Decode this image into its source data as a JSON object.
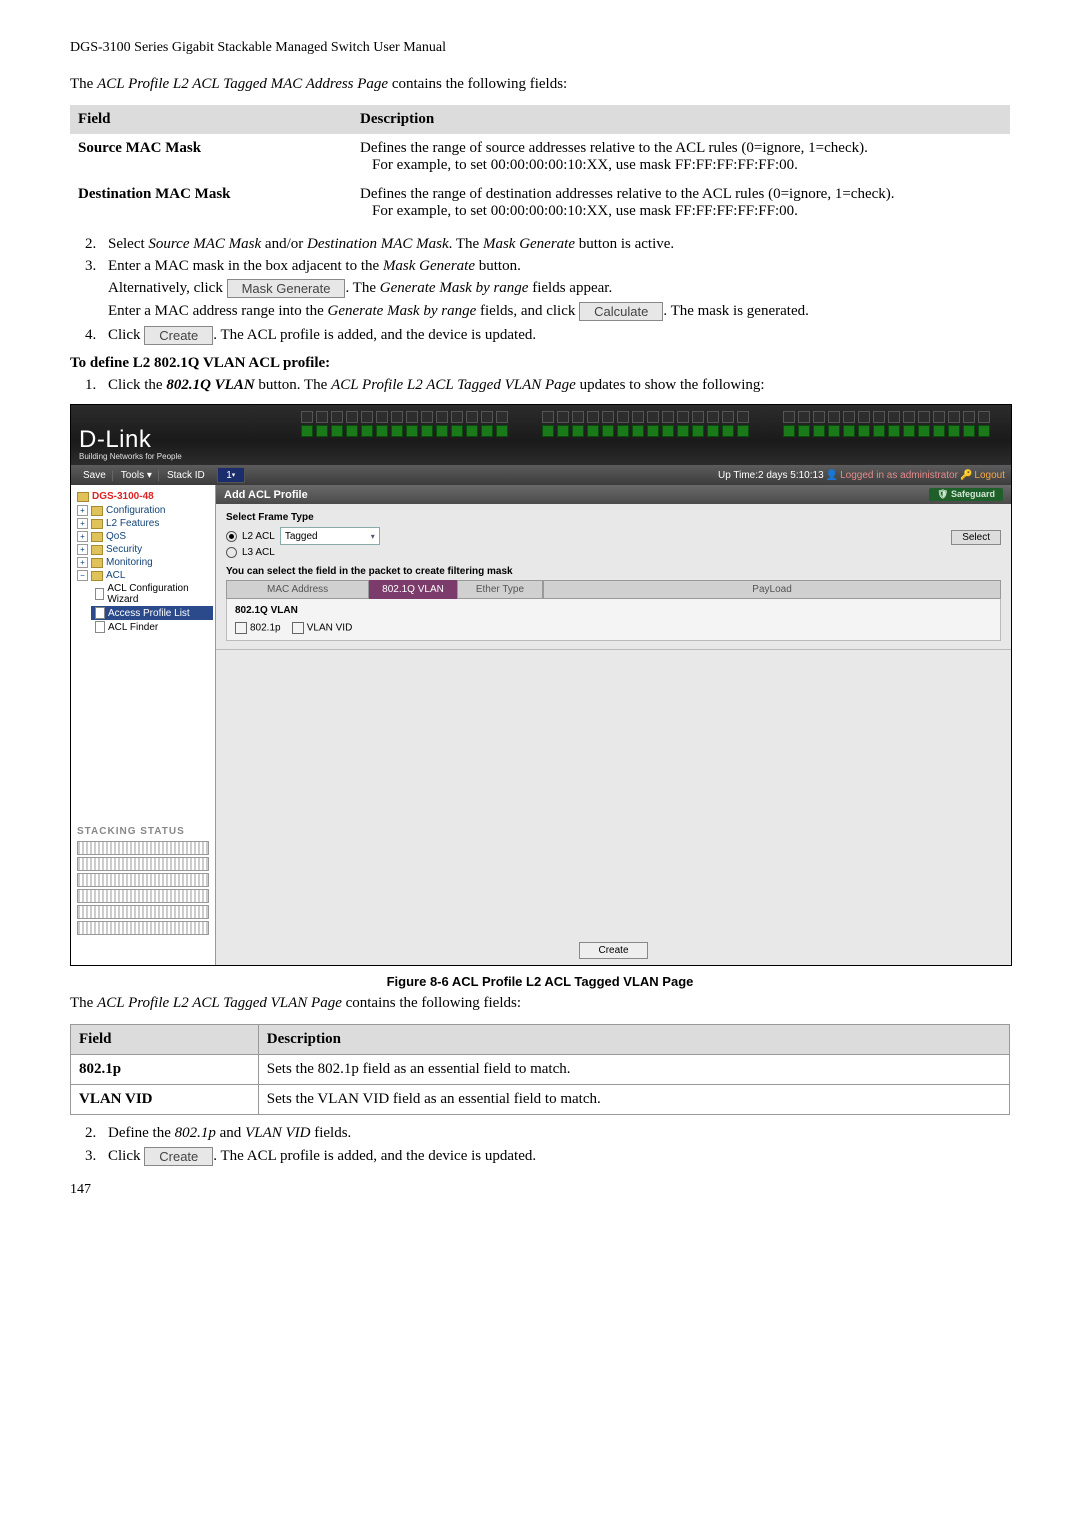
{
  "header": "DGS-3100 Series Gigabit Stackable Managed Switch User Manual",
  "intro1_prefix": "The ",
  "intro1_em": "ACL Profile L2 ACL Tagged MAC Address Page",
  "intro1_suffix": " contains the following fields:",
  "table1": {
    "col1": "Field",
    "col2": "Description",
    "rows": [
      {
        "field": "Source MAC Mask",
        "desc1": "Defines the range of source addresses relative to the ACL rules (0=ignore, 1=check).",
        "desc2": "For example, to set 00:00:00:00:10:XX, use mask FF:FF:FF:FF:FF:00."
      },
      {
        "field": "Destination MAC Mask",
        "desc1": "Defines the range of destination addresses relative to the ACL rules (0=ignore, 1=check).",
        "desc2": "For example, to set 00:00:00:00:10:XX, use mask FF:FF:FF:FF:FF:00."
      }
    ]
  },
  "steps1": {
    "s2_a": "Select ",
    "s2_b": "Source MAC Mask",
    "s2_c": " and/or ",
    "s2_d": "Destination MAC Mask",
    "s2_e": ". The ",
    "s2_f": "Mask Generate",
    "s2_g": " button is active.",
    "s3_a": "Enter a MAC mask in the box adjacent to the ",
    "s3_b": "Mask Generate",
    "s3_c": " button.",
    "s3_alt_a": "Alternatively, click ",
    "s3_alt_btn": "Mask Generate",
    "s3_alt_b": ". The ",
    "s3_alt_c": "Generate Mask by range",
    "s3_alt_d": " fields appear.",
    "s3_gen_a": "Enter a MAC address range into the ",
    "s3_gen_b": "Generate Mask by range",
    "s3_gen_c": " fields, and click ",
    "s3_gen_btn": "Calculate",
    "s3_gen_d": ". The mask is generated.",
    "s4_a": "Click ",
    "s4_btn": "Create",
    "s4_b": ". The ACL profile is added, and the device is updated."
  },
  "section2_title": "To define L2 802.1Q VLAN ACL profile:",
  "section2_step1_a": "Click the ",
  "section2_step1_b": "802.1Q VLAN",
  "section2_step1_c": " button. The ",
  "section2_step1_d": "ACL Profile L2 ACL Tagged VLAN Page",
  "section2_step1_e": " updates to show the following:",
  "screenshot": {
    "logo": "D-Link",
    "logo_sub": "Building Networks for People",
    "toolbar": {
      "save": "Save",
      "tools": "Tools",
      "stackid": "Stack ID",
      "stackid_val": "1",
      "uptime": "Up Time:2 days 5:10:13",
      "logged": "Logged in as administrator",
      "logout": "Logout"
    },
    "tree": {
      "root": "DGS-3100-48",
      "items": [
        "Configuration",
        "L2 Features",
        "QoS",
        "Security",
        "Monitoring",
        "ACL"
      ],
      "acl_children": [
        "ACL Configuration Wizard",
        "Access Profile List",
        "ACL Finder"
      ]
    },
    "stacking_heading": "STACKING STATUS",
    "main": {
      "title": "Add ACL Profile",
      "safeguard": "Safeguard",
      "frame_heading": "Select Frame Type",
      "l2_label": "L2 ACL",
      "l2_val": "Tagged",
      "l3_label": "L3 ACL",
      "select_btn": "Select",
      "note": "You can select the field in the packet to create filtering mask",
      "tabs": [
        "MAC Address",
        "802.1Q VLAN",
        "Ether Type",
        "PayLoad"
      ],
      "vlan_heading": "802.1Q VLAN",
      "chk1": "802.1p",
      "chk2": "VLAN VID",
      "create_btn": "Create"
    }
  },
  "fig_caption": "Figure 8-6 ACL Profile L2 ACL Tagged VLAN Page",
  "intro2_prefix": "The ",
  "intro2_em": "ACL Profile L2 ACL Tagged VLAN Page",
  "intro2_suffix": " contains the following fields:",
  "table2": {
    "col1": "Field",
    "col2": "Description",
    "rows": [
      {
        "field": "802.1p",
        "desc": "Sets the 802.1p field as an essential field to match."
      },
      {
        "field": "VLAN VID",
        "desc": "Sets the VLAN VID field as an essential field to match."
      }
    ]
  },
  "steps2": {
    "s2_a": "Define the ",
    "s2_b": "802.1p",
    "s2_c": " and ",
    "s2_d": "VLAN VID",
    "s2_e": " fields.",
    "s3_a": "Click ",
    "s3_btn": "Create",
    "s3_b": ". The ACL profile is added, and the device is updated."
  },
  "page_num": "147"
}
